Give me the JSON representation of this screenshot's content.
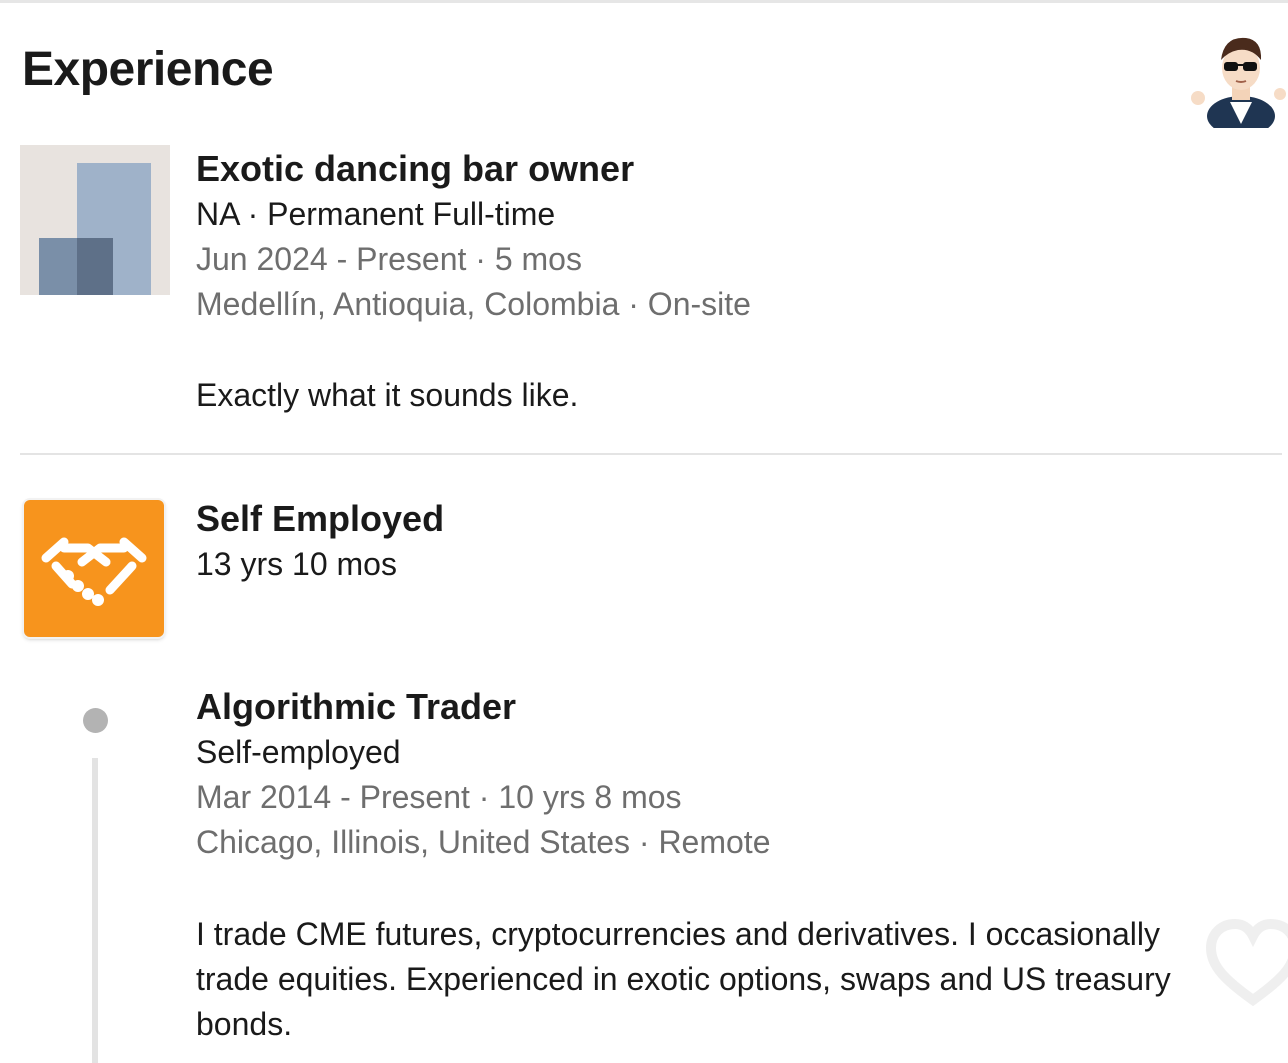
{
  "section": {
    "title": "Experience"
  },
  "experiences": [
    {
      "logo": "generic-company-logo",
      "title": "Exotic dancing bar owner",
      "subtitle": "NA · Permanent Full-time",
      "dates": "Jun 2024 - Present · 5 mos",
      "location": "Medellín, Antioquia, Colombia · On-site",
      "description": "Exactly what it sounds like."
    },
    {
      "logo": "handshake-icon",
      "title": "Self Employed",
      "subtitle": "13 yrs 10 mos",
      "roles": [
        {
          "title": "Algorithmic Trader",
          "subtitle": "Self-employed",
          "dates": "Mar 2014 - Present · 10 yrs 8 mos",
          "location": "Chicago, Illinois, United States · Remote",
          "description": "I trade CME futures, cryptocurrencies and derivatives. I occasionally trade equities. Experienced in exotic options, swaps and US treasury bonds."
        }
      ]
    }
  ],
  "icons": {
    "avatar": "cartoon-avatar-with-sunglasses",
    "overlay": "heart-icon"
  },
  "colors": {
    "accent_orange": "#f7941d",
    "muted_text": "#6e6e6e",
    "divider": "#e4e4e4"
  }
}
